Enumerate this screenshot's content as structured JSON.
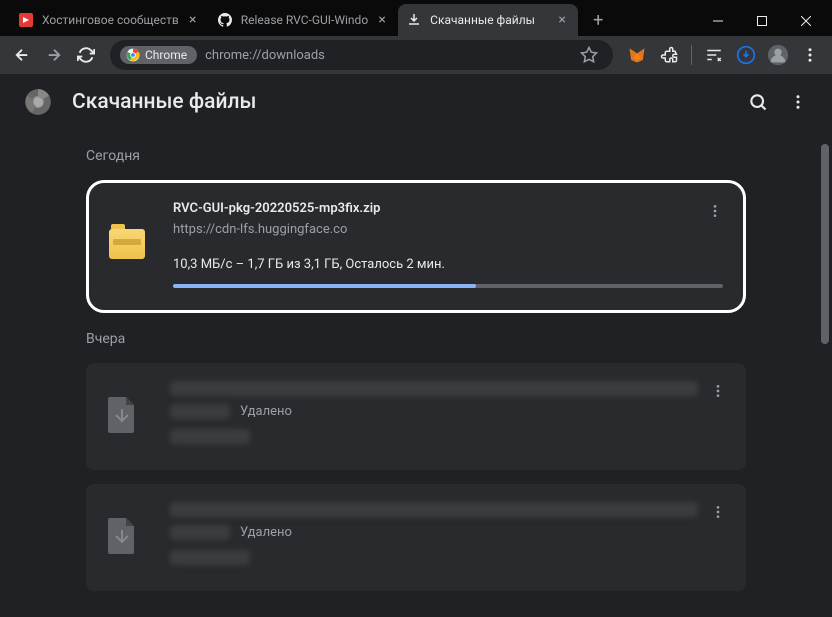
{
  "tabs": [
    {
      "title": "Хостинговое сообществ",
      "favicon_color": "#e53935"
    },
    {
      "title": "Release RVC-GUI-Windo",
      "favicon_type": "github"
    },
    {
      "title": "Скачанные файлы",
      "favicon_type": "download",
      "active": true
    }
  ],
  "omnibox": {
    "chip_label": "Chrome",
    "url": "chrome://downloads"
  },
  "page": {
    "title": "Скачанные файлы"
  },
  "date_groups": {
    "today": "Сегодня",
    "yesterday": "Вчера"
  },
  "downloads": {
    "today": [
      {
        "filename": "RVC-GUI-pkg-20220525-mp3fix.zip",
        "url": "https://cdn-lfs.huggingface.co",
        "status": "10,3 МБ/с – 1,7 ГБ из 3,1 ГБ, Осталось 2 мин.",
        "progress_pct": 55
      }
    ],
    "yesterday": [
      {
        "deleted_label": "Удалено"
      },
      {
        "deleted_label": "Удалено"
      }
    ]
  }
}
